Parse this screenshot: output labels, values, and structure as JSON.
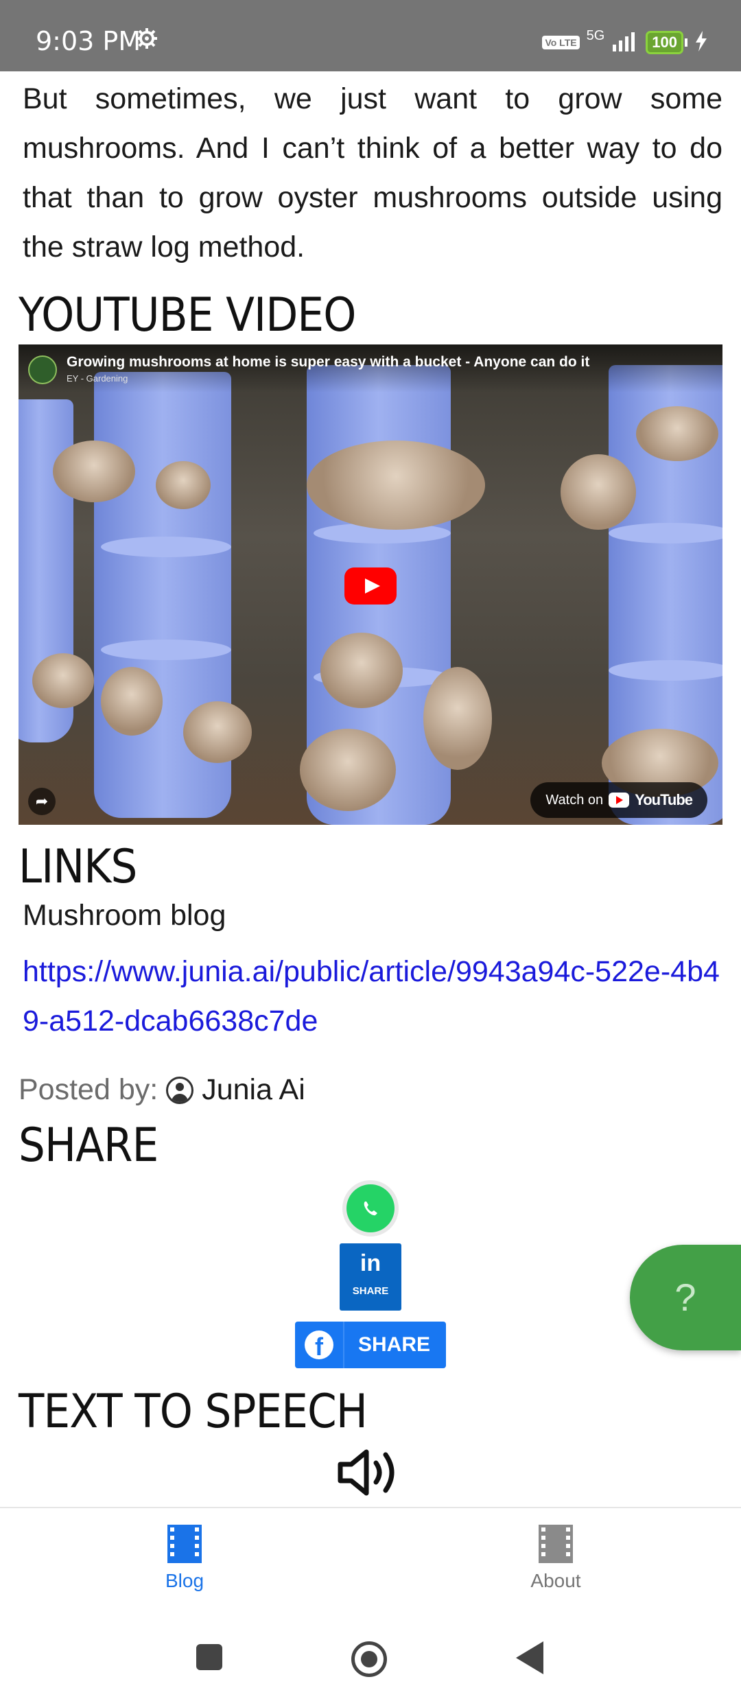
{
  "status_bar": {
    "time": "9:03 PM",
    "volte": "Vo LTE",
    "network": "5G",
    "battery": "100"
  },
  "article": {
    "paragraph": "But sometimes, we just want to grow some mushrooms. And I can’t think of a better way to do that than to grow oyster mushrooms outside using the straw log method."
  },
  "youtube": {
    "heading": "YOUTUBE VIDEO",
    "video_title": "Growing mushrooms at home is super easy with a bucket - Anyone can do it",
    "channel": "EY - Gardening",
    "watch_on": "Watch on",
    "youtube_word": "YouTube"
  },
  "links": {
    "heading": "LINKS",
    "label": "Mushroom blog",
    "url": "https://www.junia.ai/public/article/9943a94c-522e-4b49-a512-dcab6638c7de"
  },
  "posted": {
    "label": "Posted by:",
    "author": "Junia Ai"
  },
  "share": {
    "heading": "SHARE",
    "linkedin_in": "in",
    "linkedin_label": "SHARE",
    "facebook_label": "SHARE"
  },
  "help_button": {
    "label": "?"
  },
  "tts": {
    "heading": "TEXT TO SPEECH"
  },
  "bottom_nav": {
    "items": [
      {
        "label": "Blog",
        "active": true
      },
      {
        "label": "About",
        "active": false
      }
    ],
    "active_color": "#1a73e8"
  },
  "colors": {
    "status_bar": "#757575",
    "link": "#1a1adb",
    "linkedin": "#0a66c2",
    "facebook": "#1877f2",
    "whatsapp": "#25d366",
    "help": "#43a047"
  }
}
